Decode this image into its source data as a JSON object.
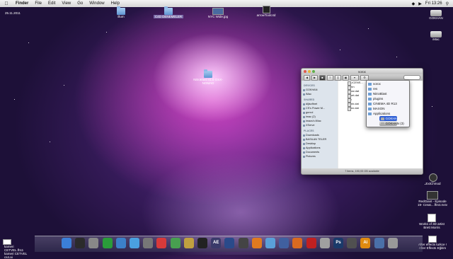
{
  "menubar": {
    "apple": "",
    "items": [
      "Finder",
      "File",
      "Edit",
      "View",
      "Go",
      "Window",
      "Help"
    ],
    "clock": "Fri 13:26"
  },
  "desktop": {
    "top_left_label": "25.11.2011",
    "icons": [
      {
        "name": "illum",
        "label": "illum"
      },
      {
        "name": "c4d-denemeler",
        "label": "C4D DENEMELER"
      },
      {
        "name": "nyc-wide",
        "label": "NYC Wide.jpg"
      },
      {
        "name": "arrow-toolc",
        "label": "arrowToolc4d"
      },
      {
        "name": "gokhan-drive",
        "label": "GOKHAN"
      },
      {
        "name": "imac",
        "label": "iMac"
      },
      {
        "name": "nitroblast",
        "label": "NitroBlast v1.0 OSX-NOMAD"
      },
      {
        "name": "extchmod",
        "label": "ExtChmod"
      },
      {
        "name": "redgiant",
        "label": "RedGiant - Episode 19- Creat....ffect.m4v"
      },
      {
        "name": "works-3d",
        "label": "Works of 3D artist Brett Morris"
      },
      {
        "name": "after-effects",
        "label": "After effects turkce ! After Effects Eğitim"
      },
      {
        "name": "kameri-1",
        "label": "kameri CETVEL.fh11"
      },
      {
        "name": "kameri-2",
        "label": "kameri CETVEL cs4.ai"
      }
    ]
  },
  "finder": {
    "title": "voroc",
    "search_placeholder": "",
    "sidebar": [
      {
        "head": "DEVICES",
        "items": [
          "GOKHAN",
          "iMac"
        ]
      },
      {
        "head": "SHARED",
        "items": [
          "dijisoftnet",
          "CS's Power M...",
          "gurcul",
          "imac (2)",
          "imacs's iMac",
          "XServe"
        ]
      },
      {
        "head": "PLACES",
        "items": [
          "Downloads",
          "BASILAN TELER",
          "Desktop",
          "Applications",
          "Documents",
          "Pictures"
        ]
      }
    ],
    "files": [
      "LICENS...",
      "mn",
      "par.dat",
      "set.dat",
      "v",
      "wh.dat",
      "wn.dat"
    ],
    "status": "7 items, 190,93 GB available"
  },
  "path_menu": {
    "items": [
      "voroc",
      "res",
      "NitroBlast",
      "plugins",
      "CINEMA 4D R13",
      "MAXON",
      "Applications",
      "GOKHAN",
      "GOKHAN (3)"
    ],
    "selected_index": 7
  },
  "dock": {
    "items": [
      {
        "name": "finder",
        "label": "",
        "color": "#3b7fd8"
      },
      {
        "name": "dashboard",
        "label": "",
        "color": "#2b2b2b"
      },
      {
        "name": "sysprefs",
        "label": "",
        "color": "#888888"
      },
      {
        "name": "itunes",
        "label": "",
        "color": "#2a9c3a"
      },
      {
        "name": "mail",
        "label": "",
        "color": "#3c80c8"
      },
      {
        "name": "safari",
        "label": "",
        "color": "#4aa0e0"
      },
      {
        "name": "bin",
        "label": "",
        "color": "#777777"
      },
      {
        "name": "calendar",
        "label": "",
        "color": "#d83a3a"
      },
      {
        "name": "app-a",
        "label": "",
        "color": "#48a050"
      },
      {
        "name": "app-b",
        "label": "",
        "color": "#c0a040"
      },
      {
        "name": "app-c",
        "label": "",
        "color": "#222222"
      },
      {
        "name": "after-effects",
        "label": "AE",
        "color": "#3a3a6a"
      },
      {
        "name": "cinema4d",
        "label": "",
        "color": "#2a4a8a"
      },
      {
        "name": "app-d",
        "label": "",
        "color": "#444444"
      },
      {
        "name": "vlc",
        "label": "",
        "color": "#e07a20"
      },
      {
        "name": "preview",
        "label": "",
        "color": "#5aa0d8"
      },
      {
        "name": "app-e",
        "label": "",
        "color": "#4060a0"
      },
      {
        "name": "firefox",
        "label": "",
        "color": "#d86a20"
      },
      {
        "name": "acrobat",
        "label": "",
        "color": "#c02020"
      },
      {
        "name": "app-f",
        "label": "",
        "color": "#a0a0a0"
      },
      {
        "name": "photoshop",
        "label": "Ps",
        "color": "#1a3a6a"
      },
      {
        "name": "app-g",
        "label": "",
        "color": "#505050"
      },
      {
        "name": "illustrator",
        "label": "Ai",
        "color": "#e08a10"
      },
      {
        "name": "downloads-stack",
        "label": "",
        "color": "#4a70a8"
      },
      {
        "name": "trash",
        "label": "",
        "color": "#999999"
      }
    ]
  }
}
